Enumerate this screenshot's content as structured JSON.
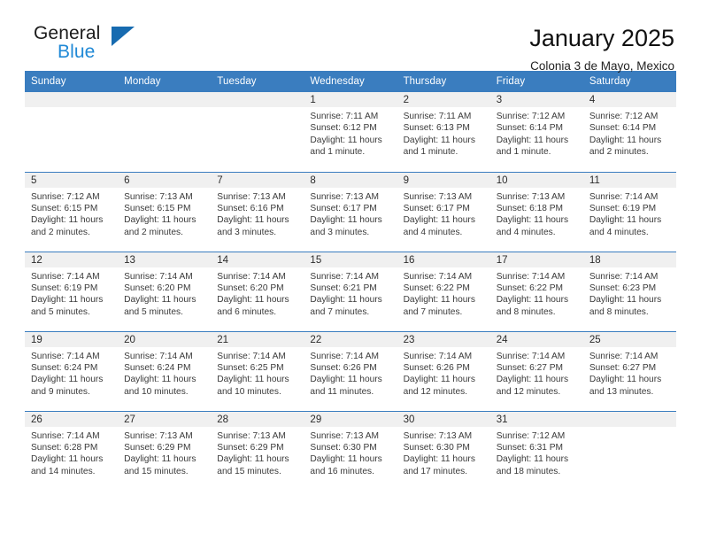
{
  "brand": {
    "name_part1": "General",
    "name_part2": "Blue",
    "triangle_icon": "triangle-logo-icon",
    "accent_color": "#2089d6"
  },
  "header": {
    "title": "January 2025",
    "subtitle": "Colonia 3 de Mayo, Mexico"
  },
  "calendar": {
    "header_bg": "#3a7dbf",
    "daynum_bg": "#f0f0f0",
    "weekday_headers": [
      "Sunday",
      "Monday",
      "Tuesday",
      "Wednesday",
      "Thursday",
      "Friday",
      "Saturday"
    ],
    "weeks": [
      [
        {
          "day": "",
          "sunrise": "",
          "sunset": "",
          "daylight": "",
          "empty": true
        },
        {
          "day": "",
          "sunrise": "",
          "sunset": "",
          "daylight": "",
          "empty": true
        },
        {
          "day": "",
          "sunrise": "",
          "sunset": "",
          "daylight": "",
          "empty": true
        },
        {
          "day": "1",
          "sunrise": "Sunrise: 7:11 AM",
          "sunset": "Sunset: 6:12 PM",
          "daylight": "Daylight: 11 hours and 1 minute."
        },
        {
          "day": "2",
          "sunrise": "Sunrise: 7:11 AM",
          "sunset": "Sunset: 6:13 PM",
          "daylight": "Daylight: 11 hours and 1 minute."
        },
        {
          "day": "3",
          "sunrise": "Sunrise: 7:12 AM",
          "sunset": "Sunset: 6:14 PM",
          "daylight": "Daylight: 11 hours and 1 minute."
        },
        {
          "day": "4",
          "sunrise": "Sunrise: 7:12 AM",
          "sunset": "Sunset: 6:14 PM",
          "daylight": "Daylight: 11 hours and 2 minutes."
        }
      ],
      [
        {
          "day": "5",
          "sunrise": "Sunrise: 7:12 AM",
          "sunset": "Sunset: 6:15 PM",
          "daylight": "Daylight: 11 hours and 2 minutes."
        },
        {
          "day": "6",
          "sunrise": "Sunrise: 7:13 AM",
          "sunset": "Sunset: 6:15 PM",
          "daylight": "Daylight: 11 hours and 2 minutes."
        },
        {
          "day": "7",
          "sunrise": "Sunrise: 7:13 AM",
          "sunset": "Sunset: 6:16 PM",
          "daylight": "Daylight: 11 hours and 3 minutes."
        },
        {
          "day": "8",
          "sunrise": "Sunrise: 7:13 AM",
          "sunset": "Sunset: 6:17 PM",
          "daylight": "Daylight: 11 hours and 3 minutes."
        },
        {
          "day": "9",
          "sunrise": "Sunrise: 7:13 AM",
          "sunset": "Sunset: 6:17 PM",
          "daylight": "Daylight: 11 hours and 4 minutes."
        },
        {
          "day": "10",
          "sunrise": "Sunrise: 7:13 AM",
          "sunset": "Sunset: 6:18 PM",
          "daylight": "Daylight: 11 hours and 4 minutes."
        },
        {
          "day": "11",
          "sunrise": "Sunrise: 7:14 AM",
          "sunset": "Sunset: 6:19 PM",
          "daylight": "Daylight: 11 hours and 4 minutes."
        }
      ],
      [
        {
          "day": "12",
          "sunrise": "Sunrise: 7:14 AM",
          "sunset": "Sunset: 6:19 PM",
          "daylight": "Daylight: 11 hours and 5 minutes."
        },
        {
          "day": "13",
          "sunrise": "Sunrise: 7:14 AM",
          "sunset": "Sunset: 6:20 PM",
          "daylight": "Daylight: 11 hours and 5 minutes."
        },
        {
          "day": "14",
          "sunrise": "Sunrise: 7:14 AM",
          "sunset": "Sunset: 6:20 PM",
          "daylight": "Daylight: 11 hours and 6 minutes."
        },
        {
          "day": "15",
          "sunrise": "Sunrise: 7:14 AM",
          "sunset": "Sunset: 6:21 PM",
          "daylight": "Daylight: 11 hours and 7 minutes."
        },
        {
          "day": "16",
          "sunrise": "Sunrise: 7:14 AM",
          "sunset": "Sunset: 6:22 PM",
          "daylight": "Daylight: 11 hours and 7 minutes."
        },
        {
          "day": "17",
          "sunrise": "Sunrise: 7:14 AM",
          "sunset": "Sunset: 6:22 PM",
          "daylight": "Daylight: 11 hours and 8 minutes."
        },
        {
          "day": "18",
          "sunrise": "Sunrise: 7:14 AM",
          "sunset": "Sunset: 6:23 PM",
          "daylight": "Daylight: 11 hours and 8 minutes."
        }
      ],
      [
        {
          "day": "19",
          "sunrise": "Sunrise: 7:14 AM",
          "sunset": "Sunset: 6:24 PM",
          "daylight": "Daylight: 11 hours and 9 minutes."
        },
        {
          "day": "20",
          "sunrise": "Sunrise: 7:14 AM",
          "sunset": "Sunset: 6:24 PM",
          "daylight": "Daylight: 11 hours and 10 minutes."
        },
        {
          "day": "21",
          "sunrise": "Sunrise: 7:14 AM",
          "sunset": "Sunset: 6:25 PM",
          "daylight": "Daylight: 11 hours and 10 minutes."
        },
        {
          "day": "22",
          "sunrise": "Sunrise: 7:14 AM",
          "sunset": "Sunset: 6:26 PM",
          "daylight": "Daylight: 11 hours and 11 minutes."
        },
        {
          "day": "23",
          "sunrise": "Sunrise: 7:14 AM",
          "sunset": "Sunset: 6:26 PM",
          "daylight": "Daylight: 11 hours and 12 minutes."
        },
        {
          "day": "24",
          "sunrise": "Sunrise: 7:14 AM",
          "sunset": "Sunset: 6:27 PM",
          "daylight": "Daylight: 11 hours and 12 minutes."
        },
        {
          "day": "25",
          "sunrise": "Sunrise: 7:14 AM",
          "sunset": "Sunset: 6:27 PM",
          "daylight": "Daylight: 11 hours and 13 minutes."
        }
      ],
      [
        {
          "day": "26",
          "sunrise": "Sunrise: 7:14 AM",
          "sunset": "Sunset: 6:28 PM",
          "daylight": "Daylight: 11 hours and 14 minutes."
        },
        {
          "day": "27",
          "sunrise": "Sunrise: 7:13 AM",
          "sunset": "Sunset: 6:29 PM",
          "daylight": "Daylight: 11 hours and 15 minutes."
        },
        {
          "day": "28",
          "sunrise": "Sunrise: 7:13 AM",
          "sunset": "Sunset: 6:29 PM",
          "daylight": "Daylight: 11 hours and 15 minutes."
        },
        {
          "day": "29",
          "sunrise": "Sunrise: 7:13 AM",
          "sunset": "Sunset: 6:30 PM",
          "daylight": "Daylight: 11 hours and 16 minutes."
        },
        {
          "day": "30",
          "sunrise": "Sunrise: 7:13 AM",
          "sunset": "Sunset: 6:30 PM",
          "daylight": "Daylight: 11 hours and 17 minutes."
        },
        {
          "day": "31",
          "sunrise": "Sunrise: 7:12 AM",
          "sunset": "Sunset: 6:31 PM",
          "daylight": "Daylight: 11 hours and 18 minutes."
        },
        {
          "day": "",
          "sunrise": "",
          "sunset": "",
          "daylight": "",
          "empty": true
        }
      ]
    ]
  }
}
